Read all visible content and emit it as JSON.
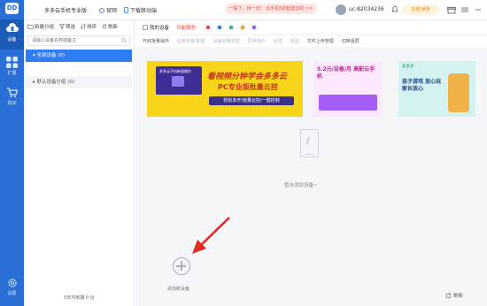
{
  "app": {
    "logo_text": "DD",
    "title": "多多云手机专业版",
    "links": {
      "website": "官网",
      "download": "下载移动端"
    },
    "promo": "一探了，持一日！ 云手机5折起送云机 >>",
    "user_id": "uc:82034236",
    "vip_label": "充值/续费"
  },
  "rail": {
    "items": [
      {
        "label": "设备",
        "icon": "cloud-phone-icon"
      },
      {
        "label": "扩展",
        "icon": "grid-icon"
      },
      {
        "label": "购买",
        "icon": "cart-icon"
      },
      {
        "label": "设置",
        "icon": "gear-icon"
      }
    ]
  },
  "groups": {
    "toolbar": {
      "new_group": "新建分组",
      "filter": "筛选",
      "sort": "排序",
      "refresh": "刷新"
    },
    "search_placeholder": "请输入设备名称或备注",
    "all_devices": "全部设备 (0)",
    "default_group": "默认设备分组 (0)",
    "footer": "0天内到期 0 台"
  },
  "main": {
    "my_devices": "我的设备",
    "channel_label": "功能服务:",
    "tools": [
      {
        "label": "开启批量操作",
        "enabled": true
      },
      {
        "label": "应用安装/卸载",
        "enabled": false
      },
      {
        "label": "设备批量管理",
        "enabled": false
      },
      {
        "label": "同步操作",
        "enabled": false
      },
      {
        "label": "全选",
        "enabled": false
      },
      {
        "label": "反选",
        "enabled": false
      },
      {
        "label": "文件上传管理",
        "enabled": true
      },
      {
        "label": "切换竖屏",
        "enabled": true
      }
    ],
    "banners": [
      {
        "headline": "看视频分钟学会多多云",
        "sub": "PC专业版批量云控",
        "caption": "轻松多开/批量云控/一键控制",
        "tag": "多多云手机新版操作"
      },
      {
        "headline": "5.2元/设备/月 高配云手机",
        "sub": "限时特惠 5.2元/设备/月"
      },
      {
        "headline": "孩子游戏 放心玩 家长放心",
        "sub": "多多云手机",
        "tag": "多多云"
      }
    ],
    "empty_text": "暂未添加设备~",
    "add_label": "添加新设备",
    "refresh_label": "刷新"
  }
}
